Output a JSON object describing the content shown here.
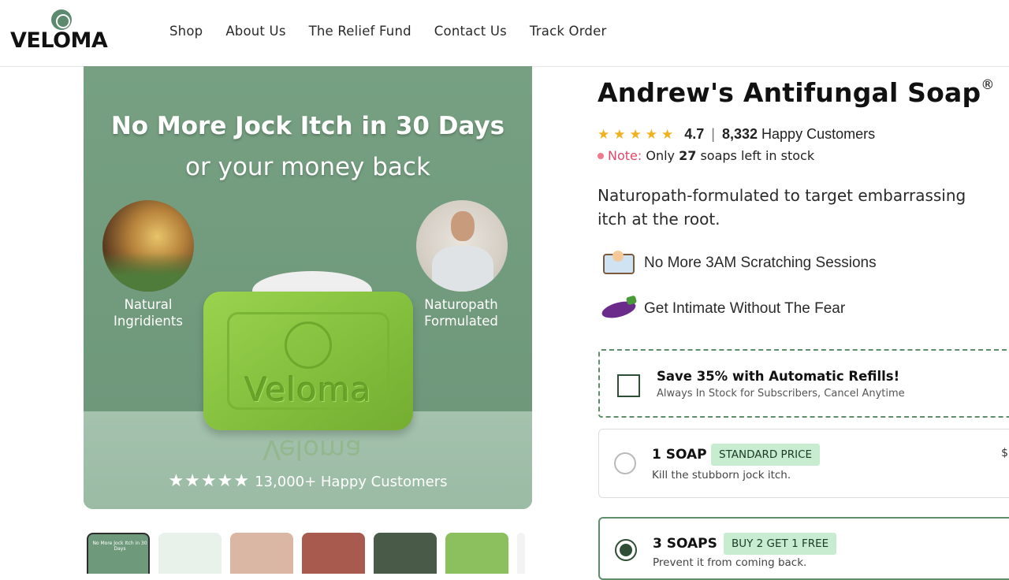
{
  "header": {
    "logo": "VELOMA",
    "nav": [
      "Shop",
      "About Us",
      "The Relief Fund",
      "Contact Us",
      "Track Order"
    ]
  },
  "hero": {
    "headline": "No More Jock Itch in 30 Days",
    "subheadline": "or your money back",
    "left_label_line1": "Natural",
    "left_label_line2": "Ingridients",
    "right_label_line1": "Naturopath",
    "right_label_line2": "Formulated",
    "soap_text": "Veloma",
    "stars": "★★★★★",
    "rating_text": "13,000+ Happy Customers"
  },
  "thumbnails": {
    "count": 7,
    "first_caption": "No More Jock Itch in 30 Days"
  },
  "product": {
    "title": "Andrew's Antifungal Soap",
    "trademark": "®",
    "stars": "★★★★★",
    "rating": "4.7",
    "separator": "|",
    "customers_count": "8,332",
    "customers_label": "Happy Customers",
    "note_label": "Note:",
    "note_prefix": "Only",
    "note_count": "27",
    "note_suffix": "soaps left in stock",
    "description_line1": "Naturopath-formulated to target embarrassing",
    "description_line2": "itch at the root.",
    "benefits": [
      {
        "icon": "sleeping-in-bed-icon",
        "text": "No More 3AM Scratching Sessions"
      },
      {
        "icon": "eggplant-icon",
        "text": "Get Intimate Without The Fear"
      }
    ]
  },
  "subscription": {
    "title": "Save 35% with Automatic Refills!",
    "subtitle": "Always In Stock for Subscribers, Cancel Anytime",
    "checked": false
  },
  "options": [
    {
      "title": "1 SOAP",
      "badge": "STANDARD PRICE",
      "subtitle": "Kill the stubborn jock itch.",
      "selected": false,
      "edge": "$"
    },
    {
      "title": "3 SOAPS",
      "badge": "BUY 2 GET 1 FREE",
      "subtitle": "Prevent it from coming back.",
      "selected": true
    }
  ],
  "colors": {
    "brand_green": "#5f8f6a",
    "star_yellow": "#f2b01e",
    "note_pink": "#e0486a",
    "badge_bg": "#c7ecd0"
  }
}
